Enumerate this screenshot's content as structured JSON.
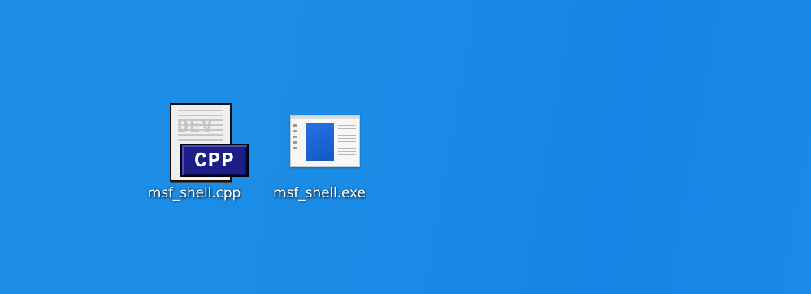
{
  "desktop": {
    "background_color": "#1b8ce6",
    "icons": [
      {
        "label": "msf_shell.cpp",
        "icon": "cpp-file-icon",
        "badge_text": "CPP",
        "watermark_text": "DEV"
      },
      {
        "label": "msf_shell.exe",
        "icon": "exe-application-icon"
      }
    ]
  }
}
